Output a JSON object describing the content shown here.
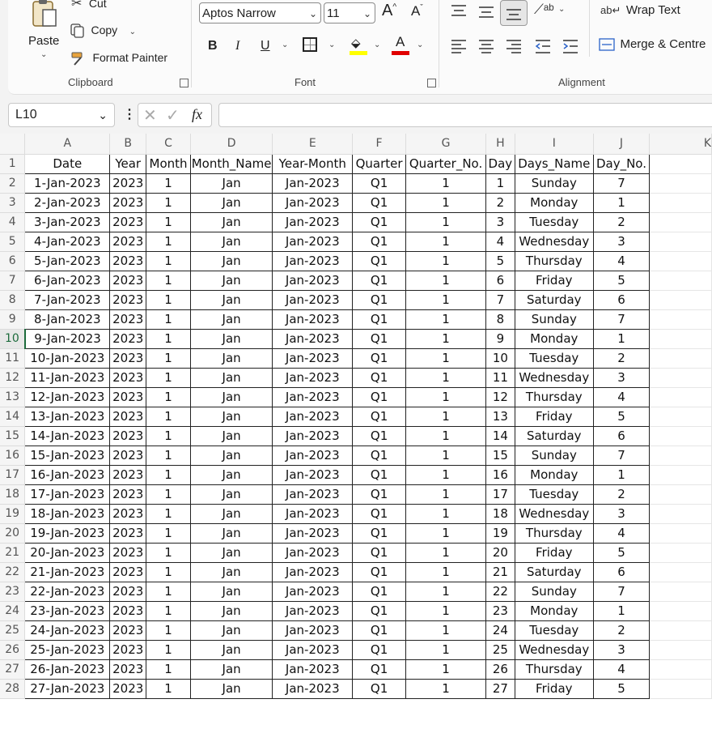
{
  "clipboard": {
    "paste_label": "Paste",
    "cut_label": "Cut",
    "copy_label": "Copy",
    "format_painter_label": "Format Painter",
    "group_label": "Clipboard"
  },
  "font": {
    "font_name": "Aptos Narrow",
    "font_size": "11",
    "bold": "B",
    "italic": "I",
    "underline": "U",
    "font_color_letter": "A",
    "group_label": "Font"
  },
  "alignment": {
    "wrap_text_label": "Wrap Text",
    "merge_label": "Merge & Centre",
    "group_label": "Alignment"
  },
  "formula_bar": {
    "name_box": "L10",
    "fx": "fx",
    "value": ""
  },
  "colors": {
    "accent_green": "#1d6b3c",
    "highlight_yellow": "#ffff00",
    "font_red": "#e00000"
  },
  "sheet": {
    "column_letters": [
      "A",
      "B",
      "C",
      "D",
      "E",
      "F",
      "G",
      "H",
      "I",
      "J",
      "K"
    ],
    "active_row": 10,
    "rows": [
      {
        "n": "1",
        "cells": [
          "Date",
          "Year",
          "Month",
          "Month_Name",
          "Year-Month",
          "Quarter",
          "Quarter_No.",
          "Day",
          "Days_Name",
          "Day_No."
        ]
      },
      {
        "n": "2",
        "cells": [
          "1-Jan-2023",
          "2023",
          "1",
          "Jan",
          "Jan-2023",
          "Q1",
          "1",
          "1",
          "Sunday",
          "7"
        ]
      },
      {
        "n": "3",
        "cells": [
          "2-Jan-2023",
          "2023",
          "1",
          "Jan",
          "Jan-2023",
          "Q1",
          "1",
          "2",
          "Monday",
          "1"
        ]
      },
      {
        "n": "4",
        "cells": [
          "3-Jan-2023",
          "2023",
          "1",
          "Jan",
          "Jan-2023",
          "Q1",
          "1",
          "3",
          "Tuesday",
          "2"
        ]
      },
      {
        "n": "5",
        "cells": [
          "4-Jan-2023",
          "2023",
          "1",
          "Jan",
          "Jan-2023",
          "Q1",
          "1",
          "4",
          "Wednesday",
          "3"
        ]
      },
      {
        "n": "6",
        "cells": [
          "5-Jan-2023",
          "2023",
          "1",
          "Jan",
          "Jan-2023",
          "Q1",
          "1",
          "5",
          "Thursday",
          "4"
        ]
      },
      {
        "n": "7",
        "cells": [
          "6-Jan-2023",
          "2023",
          "1",
          "Jan",
          "Jan-2023",
          "Q1",
          "1",
          "6",
          "Friday",
          "5"
        ]
      },
      {
        "n": "8",
        "cells": [
          "7-Jan-2023",
          "2023",
          "1",
          "Jan",
          "Jan-2023",
          "Q1",
          "1",
          "7",
          "Saturday",
          "6"
        ]
      },
      {
        "n": "9",
        "cells": [
          "8-Jan-2023",
          "2023",
          "1",
          "Jan",
          "Jan-2023",
          "Q1",
          "1",
          "8",
          "Sunday",
          "7"
        ]
      },
      {
        "n": "10",
        "cells": [
          "9-Jan-2023",
          "2023",
          "1",
          "Jan",
          "Jan-2023",
          "Q1",
          "1",
          "9",
          "Monday",
          "1"
        ]
      },
      {
        "n": "11",
        "cells": [
          "10-Jan-2023",
          "2023",
          "1",
          "Jan",
          "Jan-2023",
          "Q1",
          "1",
          "10",
          "Tuesday",
          "2"
        ]
      },
      {
        "n": "12",
        "cells": [
          "11-Jan-2023",
          "2023",
          "1",
          "Jan",
          "Jan-2023",
          "Q1",
          "1",
          "11",
          "Wednesday",
          "3"
        ]
      },
      {
        "n": "13",
        "cells": [
          "12-Jan-2023",
          "2023",
          "1",
          "Jan",
          "Jan-2023",
          "Q1",
          "1",
          "12",
          "Thursday",
          "4"
        ]
      },
      {
        "n": "14",
        "cells": [
          "13-Jan-2023",
          "2023",
          "1",
          "Jan",
          "Jan-2023",
          "Q1",
          "1",
          "13",
          "Friday",
          "5"
        ]
      },
      {
        "n": "15",
        "cells": [
          "14-Jan-2023",
          "2023",
          "1",
          "Jan",
          "Jan-2023",
          "Q1",
          "1",
          "14",
          "Saturday",
          "6"
        ]
      },
      {
        "n": "16",
        "cells": [
          "15-Jan-2023",
          "2023",
          "1",
          "Jan",
          "Jan-2023",
          "Q1",
          "1",
          "15",
          "Sunday",
          "7"
        ]
      },
      {
        "n": "17",
        "cells": [
          "16-Jan-2023",
          "2023",
          "1",
          "Jan",
          "Jan-2023",
          "Q1",
          "1",
          "16",
          "Monday",
          "1"
        ]
      },
      {
        "n": "18",
        "cells": [
          "17-Jan-2023",
          "2023",
          "1",
          "Jan",
          "Jan-2023",
          "Q1",
          "1",
          "17",
          "Tuesday",
          "2"
        ]
      },
      {
        "n": "19",
        "cells": [
          "18-Jan-2023",
          "2023",
          "1",
          "Jan",
          "Jan-2023",
          "Q1",
          "1",
          "18",
          "Wednesday",
          "3"
        ]
      },
      {
        "n": "20",
        "cells": [
          "19-Jan-2023",
          "2023",
          "1",
          "Jan",
          "Jan-2023",
          "Q1",
          "1",
          "19",
          "Thursday",
          "4"
        ]
      },
      {
        "n": "21",
        "cells": [
          "20-Jan-2023",
          "2023",
          "1",
          "Jan",
          "Jan-2023",
          "Q1",
          "1",
          "20",
          "Friday",
          "5"
        ]
      },
      {
        "n": "22",
        "cells": [
          "21-Jan-2023",
          "2023",
          "1",
          "Jan",
          "Jan-2023",
          "Q1",
          "1",
          "21",
          "Saturday",
          "6"
        ]
      },
      {
        "n": "23",
        "cells": [
          "22-Jan-2023",
          "2023",
          "1",
          "Jan",
          "Jan-2023",
          "Q1",
          "1",
          "22",
          "Sunday",
          "7"
        ]
      },
      {
        "n": "24",
        "cells": [
          "23-Jan-2023",
          "2023",
          "1",
          "Jan",
          "Jan-2023",
          "Q1",
          "1",
          "23",
          "Monday",
          "1"
        ]
      },
      {
        "n": "25",
        "cells": [
          "24-Jan-2023",
          "2023",
          "1",
          "Jan",
          "Jan-2023",
          "Q1",
          "1",
          "24",
          "Tuesday",
          "2"
        ]
      },
      {
        "n": "26",
        "cells": [
          "25-Jan-2023",
          "2023",
          "1",
          "Jan",
          "Jan-2023",
          "Q1",
          "1",
          "25",
          "Wednesday",
          "3"
        ]
      },
      {
        "n": "27",
        "cells": [
          "26-Jan-2023",
          "2023",
          "1",
          "Jan",
          "Jan-2023",
          "Q1",
          "1",
          "26",
          "Thursday",
          "4"
        ]
      },
      {
        "n": "28",
        "cells": [
          "27-Jan-2023",
          "2023",
          "1",
          "Jan",
          "Jan-2023",
          "Q1",
          "1",
          "27",
          "Friday",
          "5"
        ]
      }
    ]
  }
}
